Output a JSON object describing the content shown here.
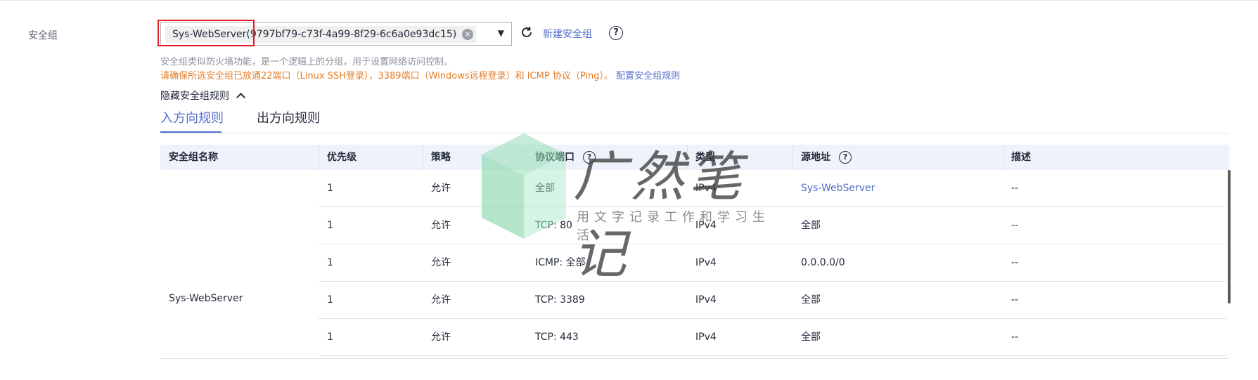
{
  "form": {
    "label": "安全组",
    "selected_group": "Sys-WebServer(9797bf79-c73f-4a99-8f29-6c6a0e93dc15)",
    "create_link": "新建安全组",
    "help": "?",
    "clear_icon": "×",
    "caret_icon": "▼",
    "refresh_icon": "refresh-icon"
  },
  "hint": {
    "line1": "安全组类似防火墙功能，是一个逻辑上的分组，用于设置网络访问控制。",
    "line2": "请确保所选安全组已放通22端口（Linux SSH登录），3389端口（Windows远程登录）和 ICMP 协议（Ping）。",
    "link": "配置安全组规则",
    "hint_color": "#e37d29",
    "link_color": "#526ecc"
  },
  "rules_toggle": {
    "label": "隐藏安全组规则"
  },
  "tabs": [
    {
      "label": "入方向规则",
      "active": true
    },
    {
      "label": "出方向规则",
      "active": false
    }
  ],
  "table": {
    "headers": [
      "安全组名称",
      "优先级",
      "策略",
      "协议端口",
      "类型",
      "源地址",
      "描述"
    ],
    "help": "?",
    "group_name": "Sys-WebServer",
    "rows": [
      {
        "priority": "1",
        "policy": "允许",
        "port": "全部",
        "type": "IPv4",
        "source": "Sys-WebServer",
        "desc": "--"
      },
      {
        "priority": "1",
        "policy": "允许",
        "port": "TCP: 80",
        "type": "IPv4",
        "source": "全部",
        "desc": "--"
      },
      {
        "priority": "1",
        "policy": "允许",
        "port": "ICMP: 全部",
        "type": "IPv4",
        "source": "0.0.0.0/0",
        "desc": "--"
      },
      {
        "priority": "1",
        "policy": "允许",
        "port": "TCP: 3389",
        "type": "IPv4",
        "source": "全部",
        "desc": "--"
      },
      {
        "priority": "1",
        "policy": "允许",
        "port": "TCP: 443",
        "type": "IPv4",
        "source": "全部",
        "desc": "--"
      }
    ]
  },
  "watermark": {
    "title": "广然笔记",
    "subtitle": "用文字记录工作和学习生活"
  }
}
